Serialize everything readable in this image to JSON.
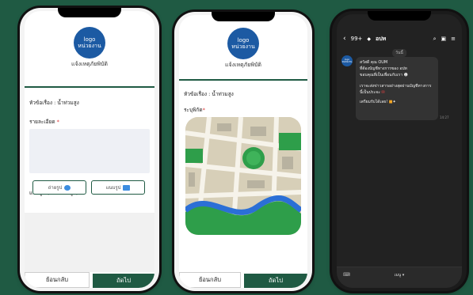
{
  "phone1": {
    "logo_line1": "logo",
    "logo_line2": "หน่วยงาน",
    "logo_subtitle": "แจ้งเหตุภัยพิบัติ",
    "topic_label": "หัวข้อเรื่อง : น้ำท่วมสูง",
    "detail_label": "รายละเอียด",
    "required_mark": "*",
    "upload_label": "แนบรูป (ไม่เกิน 3 รูป)",
    "take_photo_label": "ถ่ายรูป",
    "attach_photo_label": "แนบรูป",
    "back_label": "ย้อนกลับ",
    "next_label": "ถัดไป"
  },
  "phone2": {
    "logo_line1": "logo",
    "logo_line2": "หน่วยงาน",
    "logo_subtitle": "แจ้งเหตุภัยพิบัติ",
    "topic_label": "หัวข้อเรื่อง : น้ำท่วมสูง",
    "location_label": "ระบุพิกัด",
    "required_mark": "*",
    "back_label": "ย้อนกลับ",
    "next_label": "ถัดไป"
  },
  "phone3": {
    "header_count": "99+",
    "header_name": "อปท",
    "date_chip": "วันนี้",
    "avatar_line1": "logo",
    "avatar_line2": "หน่วยงาน",
    "msg_line1": "สวัสดี คุณ OUM",
    "msg_line2": "ที่ต้องบัญชีทางการของ อปท",
    "msg_line3": "ขอบคุณที่เป็นเพื่อนกับเรา",
    "msg_line4": "เราจะส่งข่าวสารอย่างสุดผ่านบัญชีทางการ",
    "msg_line5": "นี้เป็นประจะ",
    "msg_line6": "เตรียมรับได้เลย!",
    "msg_time": "14:27",
    "menu_label": "เมนู ▾"
  },
  "colors": {
    "background": "#1f5a43",
    "brand_green": "#1f5a43",
    "logo_blue": "#1c5aa3",
    "required_red": "#d33333"
  }
}
